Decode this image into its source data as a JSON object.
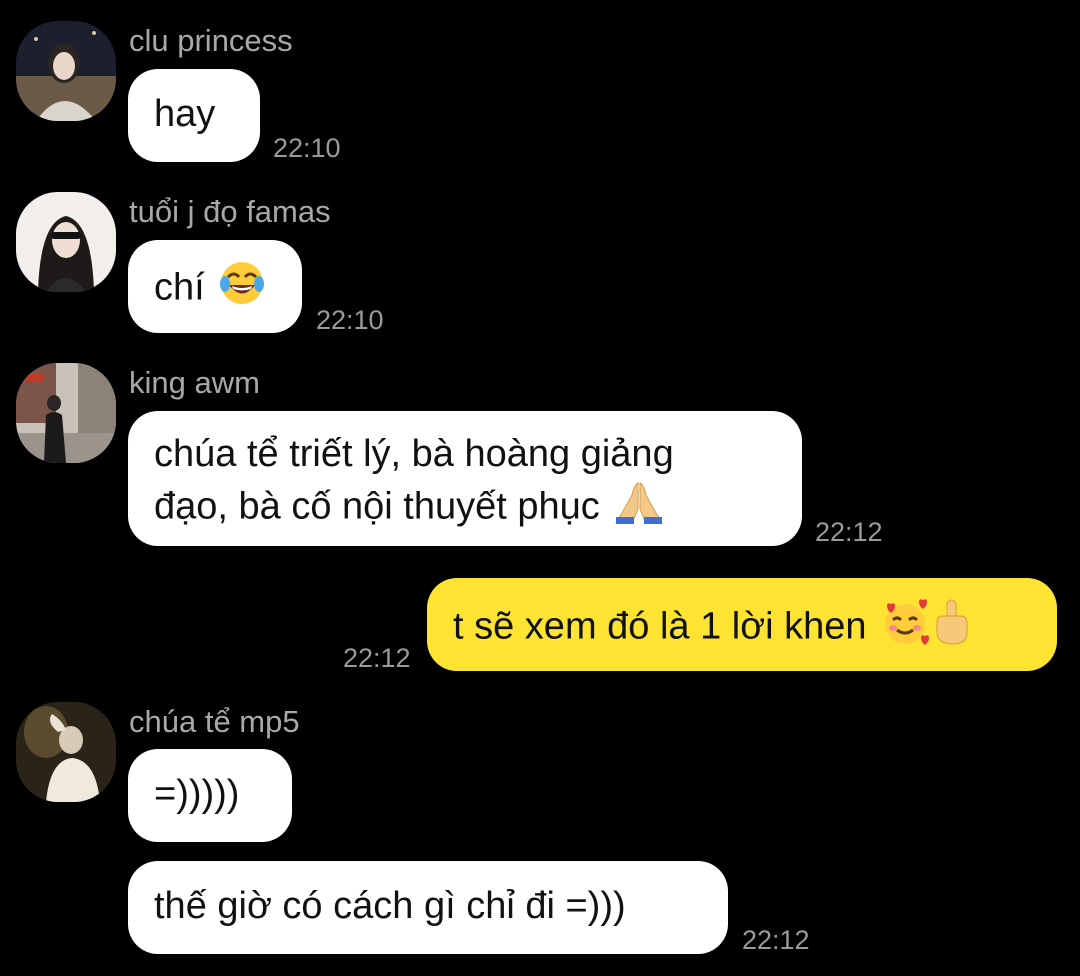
{
  "conversation": {
    "messages": [
      {
        "sender": "clu princess",
        "avatar": "avatar-girl-night",
        "text": "hay",
        "time": "22:10"
      },
      {
        "sender": "tuổi j đọ famas",
        "avatar": "avatar-girl-sunglasses",
        "text": "chí",
        "emoji": "face-with-tears-of-joy",
        "time": "22:10"
      },
      {
        "sender": "king awm",
        "avatar": "avatar-street",
        "line1": "chúa tể triết lý, bà hoàng giảng",
        "line2": "đạo, bà cố nội thuyết phục",
        "emoji": "folded-hands",
        "time": "22:12"
      },
      {
        "sender": "me",
        "text": "t sẽ xem đó là 1 lời khen",
        "emoji1": "smiling-face-with-hearts",
        "emoji2": "middle-finger",
        "time": "22:12"
      },
      {
        "sender": "chúa tể mp5",
        "avatar": "avatar-boy",
        "text1": "=)))))",
        "text2": "thế giờ có cách gì chỉ đi =)))",
        "time": "22:12"
      }
    ]
  },
  "colors": {
    "background": "#000000",
    "incoming_bubble": "#ffffff",
    "outgoing_bubble": "#fde433",
    "sender_name": "#a8a8a8",
    "timestamp": "#9a9a9a"
  }
}
